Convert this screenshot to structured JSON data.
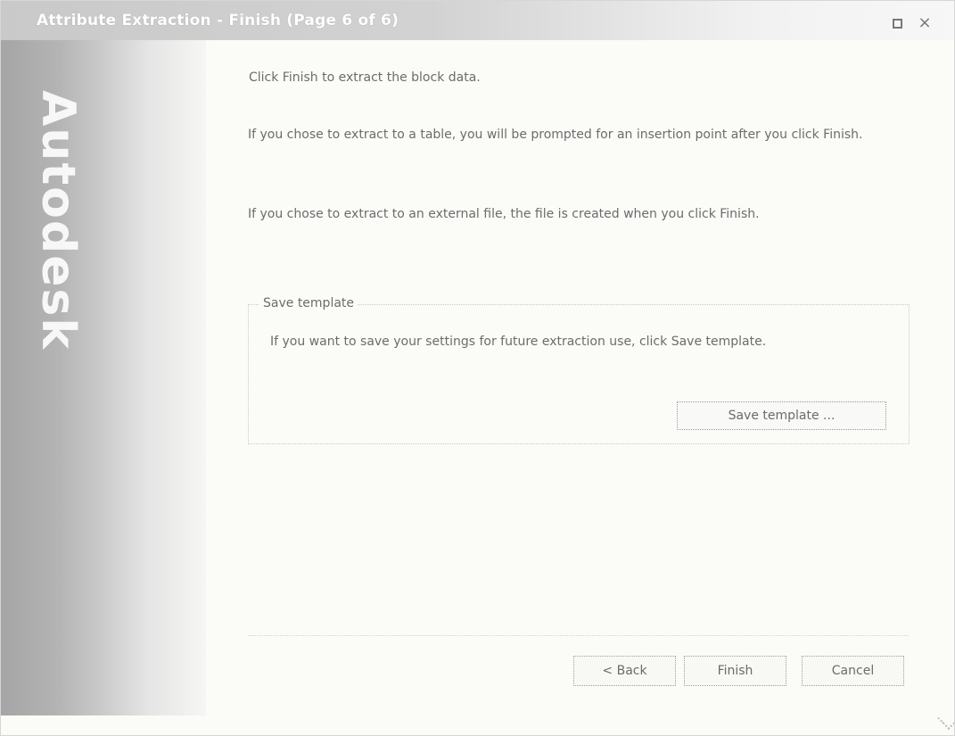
{
  "window": {
    "title": "Attribute Extraction - Finish (Page 6 of 6)",
    "controls": {
      "maximize": "maximize-icon",
      "close": "close-icon"
    }
  },
  "sidebar": {
    "brand": "Autodesk"
  },
  "content": {
    "line1": "Click Finish to extract the block data.",
    "line2": "If you chose to extract to a table, you will be prompted for an insertion point after you click Finish.",
    "line3": "If you chose to extract to an external file, the file is created when you click Finish."
  },
  "save_template_group": {
    "title": "Save template",
    "text": "If you want to save your settings for future extraction use, click Save template.",
    "button": "Save template ..."
  },
  "footer": {
    "back_button": "< Back",
    "finish_button": "Finish",
    "cancel_button": "Cancel"
  }
}
